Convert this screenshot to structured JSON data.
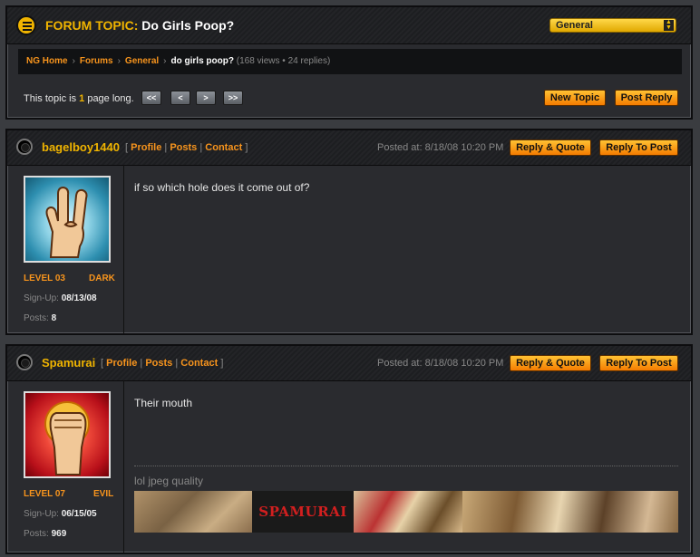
{
  "topic": {
    "label": "FORUM TOPIC:",
    "title": "Do Girls Poop?",
    "category_select": "General"
  },
  "breadcrumb": {
    "home": "NG Home",
    "forums": "Forums",
    "category": "General",
    "current": "do girls poop?",
    "meta": "(168 views • 24 replies)"
  },
  "pagination": {
    "prefix": "This topic is ",
    "pages": "1",
    "suffix": " page long.",
    "first": "<<",
    "prev": "<",
    "next": ">",
    "last": ">>"
  },
  "actions": {
    "new_topic": "New Topic",
    "post_reply": "Post Reply"
  },
  "posts": [
    {
      "username": "bagelboy1440",
      "link_open": "[",
      "profile": "Profile",
      "sep": "|",
      "posts_link": "Posts",
      "contact": "Contact",
      "link_close": "]",
      "posted": "Posted at: 8/18/08 10:20 PM",
      "reply_quote": "Reply & Quote",
      "reply_to_post": "Reply To Post",
      "level": "LEVEL 03",
      "alignment": "DARK",
      "signup_label": "Sign-Up: ",
      "signup": "08/13/08",
      "posts_label": "Posts: ",
      "post_count": "8",
      "body": "if so which hole does it come out of?"
    },
    {
      "username": "Spamurai",
      "link_open": "[",
      "profile": "Profile",
      "sep": "|",
      "posts_link": "Posts",
      "contact": "Contact",
      "link_close": "]",
      "posted": "Posted at: 8/18/08 10:20 PM",
      "reply_quote": "Reply & Quote",
      "reply_to_post": "Reply To Post",
      "level": "LEVEL 07",
      "alignment": "EVIL",
      "signup_label": "Sign-Up: ",
      "signup": "06/15/05",
      "posts_label": "Posts: ",
      "post_count": "969",
      "body": "Their mouth",
      "signature_text": "lol jpeg quality",
      "signature_banner": "SPAMURAI"
    }
  ],
  "colors": {
    "accent_yellow": "#f0b400",
    "accent_orange": "#f7941d",
    "panel_bg": "#2a2b2f"
  }
}
